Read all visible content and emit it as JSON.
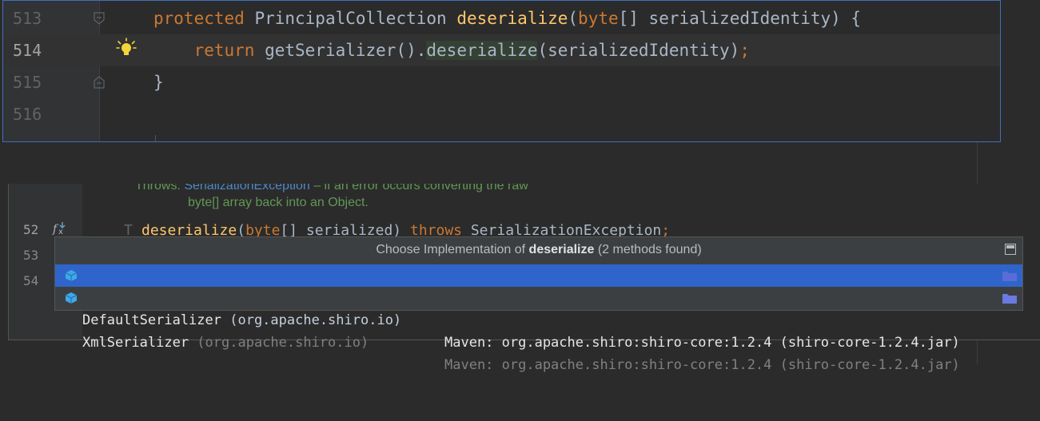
{
  "top_editor": {
    "lines": [
      {
        "num": "513",
        "tokens": [
          {
            "t": "protected ",
            "c": "kw"
          },
          {
            "t": "PrincipalCollection ",
            "c": "plain"
          },
          {
            "t": "deserialize",
            "c": "fn"
          },
          {
            "t": "(",
            "c": "plain"
          },
          {
            "t": "byte",
            "c": "kw"
          },
          {
            "t": "[] serializedIdentity) {",
            "c": "plain"
          }
        ]
      },
      {
        "num": "514",
        "tokens": [
          {
            "t": "    "
          },
          {
            "t": "return ",
            "c": "kw"
          },
          {
            "t": "getSerializer().",
            "c": "plain"
          },
          {
            "t": "deserialize",
            "c": "plain hl"
          },
          {
            "t": "(serializedIdentity)",
            "c": "plain"
          },
          {
            "t": ";",
            "c": "kw"
          }
        ]
      },
      {
        "num": "515",
        "tokens": [
          {
            "t": "}",
            "c": "plain"
          }
        ]
      },
      {
        "num": "516",
        "tokens": []
      }
    ],
    "icons": {
      "fold_start": "fold-start-icon",
      "fold_end": "fold-end-icon",
      "intention": "lightbulb-icon"
    }
  },
  "bottom_editor": {
    "doc_line1_prefix": "Throws: ",
    "doc_line1_link": "SerializationException",
    "doc_line1_rest": " – if an error occurs converting the raw",
    "doc_line2": "byte[] array back into an Object.",
    "line_numbers": [
      "52",
      "53",
      "54"
    ],
    "code_tokens": [
      {
        "t": "deserialize",
        "c": "fn"
      },
      {
        "t": "(",
        "c": "plain"
      },
      {
        "t": "byte",
        "c": "kw"
      },
      {
        "t": "[] serialized) ",
        "c": "plain"
      },
      {
        "t": "throws ",
        "c": "kw"
      },
      {
        "t": "SerializationException",
        "c": "plain"
      },
      {
        "t": ";",
        "c": "kw"
      }
    ],
    "gutter_icon": "fx-implementations-icon",
    "type_param": "T"
  },
  "popup": {
    "title_prefix": "Choose Implementation of ",
    "title_method": "deserialize",
    "title_suffix": " (2 methods found)",
    "items": [
      {
        "class_name": "DefaultSerializer",
        "package": " (org.apache.shiro.io)",
        "location": "Maven: org.apache.shiro:shiro-core:1.2.4 (shiro-core-1.2.4.jar)",
        "selected": true
      },
      {
        "class_name": "XmlSerializer",
        "package": " (org.apache.shiro.io)",
        "location": "Maven: org.apache.shiro:shiro-core:1.2.4 (shiro-core-1.2.4.jar)",
        "selected": false
      }
    ]
  },
  "colors": {
    "keyword": "#cc7832",
    "function": "#ffc66d",
    "text": "#a9b7c6",
    "selection": "#2f65ca",
    "doc": "#629755",
    "link": "#4c89c7"
  }
}
